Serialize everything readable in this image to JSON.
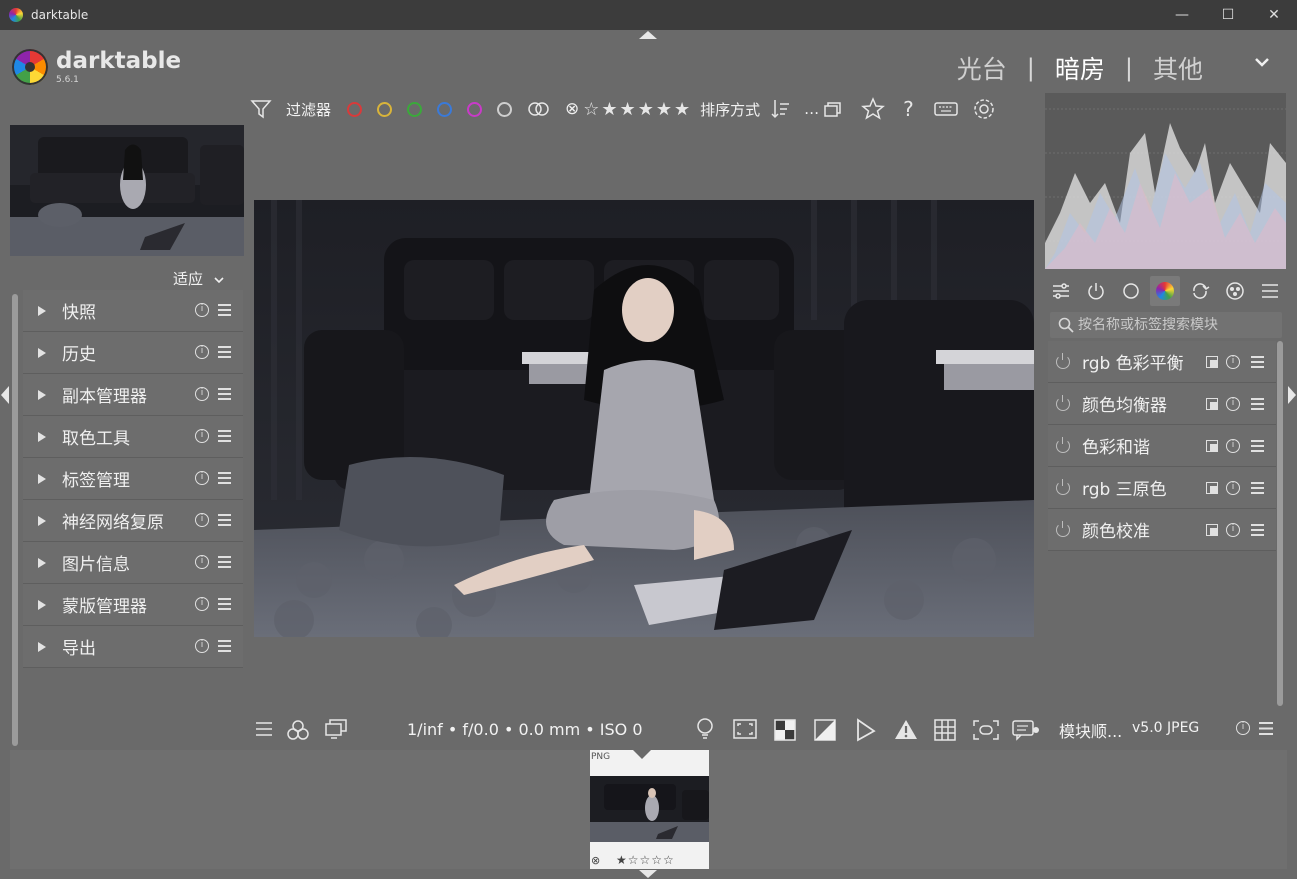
{
  "window": {
    "title": "darktable",
    "minimize": "—",
    "maximize": "☐",
    "close": "✕"
  },
  "header": {
    "app_name": "darktable",
    "version": "5.6.1",
    "views": [
      {
        "label": "光台"
      },
      {
        "label": "暗房"
      },
      {
        "label": "其他"
      }
    ],
    "active_view": "暗房"
  },
  "left_panel": {
    "zoom_label": "适应",
    "modules": [
      {
        "label": "快照"
      },
      {
        "label": "历史"
      },
      {
        "label": "副本管理器"
      },
      {
        "label": "取色工具"
      },
      {
        "label": "标签管理"
      },
      {
        "label": "神经网络复原"
      },
      {
        "label": "图片信息"
      },
      {
        "label": "蒙版管理器"
      },
      {
        "label": "导出"
      }
    ]
  },
  "top_toolbar": {
    "filter_label": "过滤器",
    "color_labels": [
      "#d93a3a",
      "#d9b43a",
      "#3aaa3a",
      "#3a7ad9",
      "#c93ac9"
    ],
    "sort_label": "排序方式",
    "ellipsis": "…",
    "help": "?"
  },
  "bottom_toolbar": {
    "exif": "1/inf • f/0.0 • 0.0 mm • ISO 0",
    "style_label": "模块顺...",
    "style_version": "v5.0 JPEG"
  },
  "right_panel": {
    "search_placeholder": "按名称或标签搜索模块",
    "modules": [
      {
        "label": "rgb 色彩平衡"
      },
      {
        "label": "颜色均衡器"
      },
      {
        "label": "色彩和谐"
      },
      {
        "label": "rgb 三原色"
      },
      {
        "label": "颜色校准"
      }
    ]
  },
  "filmstrip": {
    "format": "PNG",
    "reject": "⊗",
    "stars": "★☆☆☆☆"
  }
}
